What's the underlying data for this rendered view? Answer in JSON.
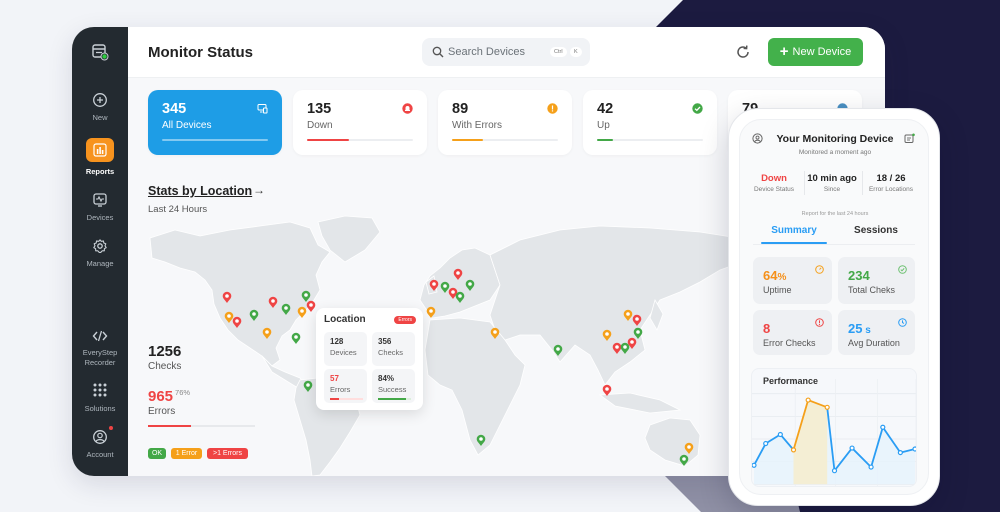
{
  "colors": {
    "brand_blue": "#1e9de6",
    "ok_green": "#43a847",
    "warning_orange": "#f5a01a",
    "error_red": "#ef4444",
    "navy_background": "#1c1b40",
    "sidebar_bg": "#232a30",
    "active_nav": "#f7931e",
    "tab_blue": "#2a9df4",
    "primary_button": "#43b14b"
  },
  "sidebar": {
    "logo_icon": "server-status-icon",
    "items": [
      {
        "label": "New",
        "icon": "plus-circle-icon"
      },
      {
        "label": "Reports",
        "icon": "bar-chart-icon",
        "active": true
      },
      {
        "label": "Devices",
        "icon": "device-pulse-icon"
      },
      {
        "label": "Manage",
        "icon": "gear-icon"
      },
      {
        "label_lines": [
          "EveryStep",
          "Recorder"
        ],
        "icon": "code-icon"
      },
      {
        "label": "Solutions",
        "icon": "grid-icon"
      },
      {
        "label": "Account",
        "icon": "user-circle-icon",
        "has_notification": true
      }
    ]
  },
  "header": {
    "title": "Monitor Status",
    "search": {
      "placeholder": "Search Devices",
      "icon": "search-icon",
      "shortcut": [
        "Ctrl",
        "K"
      ]
    },
    "refresh_icon": "refresh-icon",
    "new_device": {
      "label": "New Device",
      "icon": "plus-icon"
    }
  },
  "stat_cards": [
    {
      "value": "345",
      "label": "All Devices",
      "icon": "devices-icon",
      "color": "#ffffff",
      "fill": 1.0
    },
    {
      "value": "135",
      "label": "Down",
      "icon": "alert-icon",
      "color": "#ef4444",
      "fill": 0.4
    },
    {
      "value": "89",
      "label": "With Errors",
      "icon": "warning-icon",
      "color": "#f5a01a",
      "fill": 0.29
    },
    {
      "value": "42",
      "label": "Up",
      "icon": "check-circle-icon",
      "color": "#43a847",
      "fill": 0.15
    },
    {
      "value": "79",
      "icon": "circle-status-icon",
      "color": "#4a90c2"
    }
  ],
  "location": {
    "title": "Stats by Location",
    "arrow": "→",
    "subtitle": "Last 24 Hours",
    "checks_value": "1256",
    "checks_label": "Checks",
    "errors_value": "965",
    "errors_percent": "76%",
    "errors_label": "Errors",
    "errors_fill": 0.4,
    "legend": [
      {
        "label": "OK",
        "status": "ok",
        "color": "#43a847"
      },
      {
        "label": "1 Error",
        "status": "warning",
        "color": "#f5a01a"
      },
      {
        "label": ">1 Errors",
        "status": "error",
        "color": "#ef4444"
      }
    ],
    "popup": {
      "title": "Location",
      "badge": "Errors",
      "cells": [
        {
          "value": "128",
          "label": "Devices"
        },
        {
          "value": "356",
          "label": "Checks"
        },
        {
          "value": "57",
          "label": "Errors",
          "fill": 0.26
        },
        {
          "value": "84%",
          "label": "Success",
          "fill": 0.84
        }
      ]
    }
  },
  "map": {
    "pins": [
      {
        "status": "error"
      },
      {
        "status": "error"
      },
      {
        "status": "ok"
      },
      {
        "status": "error"
      },
      {
        "status": "ok"
      },
      {
        "status": "warning"
      },
      {
        "status": "warning"
      },
      {
        "status": "error"
      },
      {
        "status": "ok"
      },
      {
        "status": "warning"
      },
      {
        "status": "ok"
      },
      {
        "status": "ok"
      },
      {
        "status": "error"
      },
      {
        "status": "error"
      },
      {
        "status": "ok"
      },
      {
        "status": "error"
      },
      {
        "status": "ok"
      },
      {
        "status": "ok"
      },
      {
        "status": "warning"
      },
      {
        "status": "warning"
      },
      {
        "status": "ok"
      },
      {
        "status": "warning"
      },
      {
        "status": "error"
      },
      {
        "status": "warning"
      },
      {
        "status": "ok"
      },
      {
        "status": "error"
      },
      {
        "status": "error"
      },
      {
        "status": "ok"
      },
      {
        "status": "error"
      },
      {
        "status": "ok"
      },
      {
        "status": "warning"
      },
      {
        "status": "ok"
      }
    ]
  },
  "phone": {
    "title": "Your Monitoring Device",
    "subtitle": "Monitored a moment ago",
    "left_icon": "user-circle-icon",
    "right_icon": "device-list-icon",
    "stats": [
      {
        "value": "Down",
        "label": "Device Status"
      },
      {
        "value": "10 min ago",
        "label": "Since"
      },
      {
        "value": "18 / 26",
        "label": "Error Locations"
      }
    ],
    "report_note": "Report for the last 24 hours",
    "tabs": [
      {
        "label": "Summary",
        "active": true
      },
      {
        "label": "Sessions"
      }
    ],
    "metrics": [
      {
        "value": "64",
        "unit": "%",
        "label": "Uptime",
        "icon": "gauge-icon",
        "color": "#f5901a"
      },
      {
        "value": "234",
        "unit": "",
        "label": "Total Cheks",
        "icon": "check-circle-icon",
        "color": "#43a847"
      },
      {
        "value": "8",
        "unit": "",
        "label": "Error Checks",
        "icon": "error-icon",
        "color": "#ef4444"
      },
      {
        "value": "25",
        "unit": " s",
        "label": "Avg Duration",
        "icon": "clock-icon",
        "color": "#2a9df4"
      }
    ],
    "performance": {
      "title": "Performance"
    }
  },
  "chart_data": {
    "type": "line",
    "title": "Performance",
    "xlabel": "",
    "ylabel": "",
    "x": [
      0,
      0.8,
      1.8,
      2.7,
      3.7,
      5.0,
      5.5,
      6.7,
      8.0,
      8.8,
      10.0,
      11.0
    ],
    "series": [
      {
        "name": "Performance",
        "values": [
          21,
          45,
          55,
          38,
          93,
          85,
          15,
          40,
          19,
          63,
          35,
          39
        ],
        "color": "#2a9df4"
      }
    ],
    "highlight": {
      "from_index": 3,
      "to_index": 5,
      "color": "#f5a01a"
    },
    "xlim": [
      0,
      11
    ],
    "ylim": [
      0,
      100
    ],
    "grid": true,
    "legend": "none"
  }
}
